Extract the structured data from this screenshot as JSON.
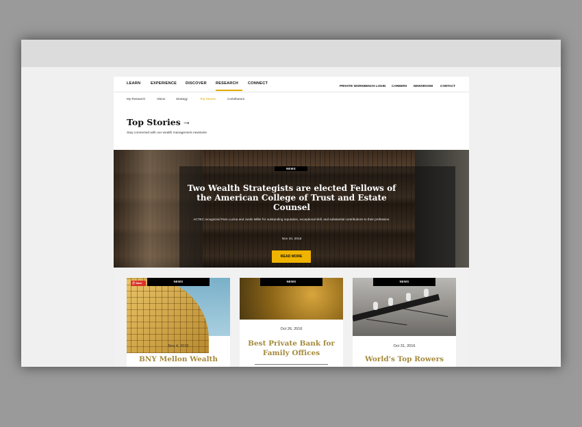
{
  "nav": {
    "primary": [
      "LEARN",
      "EXPERIENCE",
      "DISCOVER",
      "RESEARCH",
      "CONNECT"
    ],
    "active": "RESEARCH",
    "utility": [
      "PRIVATE WORKBENCH LOGIN",
      "CAREERS",
      "NEWSROOM",
      "CONTACT"
    ]
  },
  "subnav": {
    "items": [
      "My Research",
      "Vision",
      "Strategy",
      "Top Stories",
      "Contributors"
    ],
    "active": "Top Stories"
  },
  "section": {
    "title": "Top Stories",
    "subtitle": "Stay connected with our wealth management newswire"
  },
  "hero": {
    "badge": "NEWS",
    "title": "Two Wealth Strategists are elected Fellows of the American College of Trust and Estate Counsel",
    "description": "ACTEC recognized Pam Lucina and Justin Miller for outstanding reputation, exceptional skill, and substantial contributions to their profession.",
    "date": "Nov 10, 2016",
    "button": "READ MORE"
  },
  "cards": [
    {
      "badge": "NEWS",
      "save": "Save",
      "date": "Nov 4, 2016",
      "title": "BNY Mellon Wealth"
    },
    {
      "badge": "NEWS",
      "date": "Oct 26, 2016",
      "title": "Best Private Bank for Family Offices"
    },
    {
      "badge": "NEWS",
      "date": "Oct 31, 2016",
      "title": "World's Top Rowers"
    }
  ],
  "colors": {
    "accent": "#e0a800",
    "button": "#f0b400",
    "card_title": "#a48a3c"
  }
}
